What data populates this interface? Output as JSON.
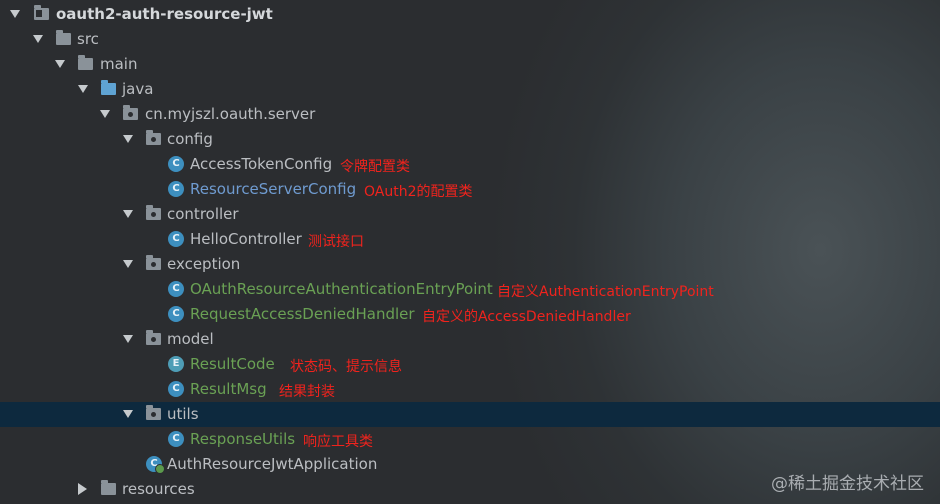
{
  "tree": {
    "project": "oauth2-auth-resource-jwt",
    "src": "src",
    "main": "main",
    "java": "java",
    "package": "cn.myjszl.oauth.server",
    "config": {
      "label": "config",
      "access_token_config": {
        "name": "AccessTokenConfig",
        "note": "令牌配置类"
      },
      "resource_server_config": {
        "name": "ResourceServerConfig",
        "note": "OAuth2的配置类"
      }
    },
    "controller": {
      "label": "controller",
      "hello_controller": {
        "name": "HelloController",
        "note": "测试接口"
      }
    },
    "exception": {
      "label": "exception",
      "entry_point": {
        "name": "OAuthResourceAuthenticationEntryPoint",
        "note": "自定义AuthenticationEntryPoint"
      },
      "denied_handler": {
        "name": "RequestAccessDeniedHandler",
        "note": "自定义的AccessDeniedHandler"
      }
    },
    "model": {
      "label": "model",
      "result_code": {
        "name": "ResultCode",
        "note": "状态码、提示信息"
      },
      "result_msg": {
        "name": "ResultMsg",
        "note": "结果封装"
      }
    },
    "utils": {
      "label": "utils",
      "response_utils": {
        "name": "ResponseUtils",
        "note": "响应工具类"
      }
    },
    "application": "AuthResourceJwtApplication",
    "resources": "resources"
  },
  "icons": {
    "class_letter": "C",
    "enum_letter": "E"
  },
  "watermark": "@稀土掘金技术社区",
  "colors": {
    "background": "#2b2d30",
    "selection": "#0d293e",
    "note_red": "#f0231d",
    "modified_blue": "#6f9bd0",
    "added_green": "#6aa154"
  }
}
